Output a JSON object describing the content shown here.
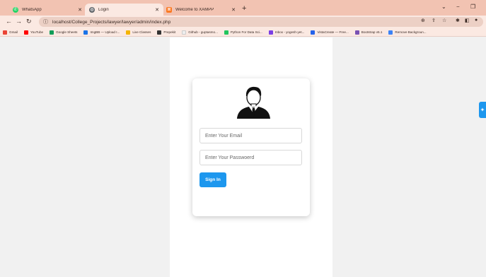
{
  "tabs": [
    {
      "label": "WhatsApp",
      "icon": "whatsapp-icon",
      "color": "#25d366"
    },
    {
      "label": "Login",
      "icon": "globe-icon",
      "color": "#5f6368"
    },
    {
      "label": "Welcome to XAMPP",
      "icon": "xampp-icon",
      "color": "#fb7a24"
    }
  ],
  "new_tab": "+",
  "address": {
    "url": "localhost/College_Projects/lawyer/lawyer/admin/index.php"
  },
  "bookmarks": [
    {
      "label": "Gmail",
      "color": "#ea4335"
    },
    {
      "label": "YouTube",
      "color": "#ff0000"
    },
    {
      "label": "Google Sheets",
      "color": "#0f9d58"
    },
    {
      "label": "ImgBB — Upload I...",
      "color": "#1a73e8"
    },
    {
      "label": "Live Classes",
      "color": "#f4b400"
    },
    {
      "label": "Prepekit",
      "color": "#333333"
    },
    {
      "label": "Github - guptasmo...",
      "color": "#eeeeee"
    },
    {
      "label": "Python For Data Sci...",
      "color": "#22c55e"
    },
    {
      "label": "Inbox - yogesh-yet...",
      "color": "#7b3fe4"
    },
    {
      "label": "VistaCreate — Free...",
      "color": "#2563eb"
    },
    {
      "label": "Bootstrap v5.1",
      "color": "#7952b3"
    },
    {
      "label": "Remove Backgroun...",
      "color": "#3b82f6"
    }
  ],
  "login": {
    "email_placeholder": "Enter Your Email",
    "password_placeholder": "Enter Your Passwoerd",
    "signin_label": "Sign In"
  },
  "colors": {
    "accent": "#1d97ee",
    "tabstrip": "#f2c3b2",
    "toolbar": "#fbe9e2"
  }
}
